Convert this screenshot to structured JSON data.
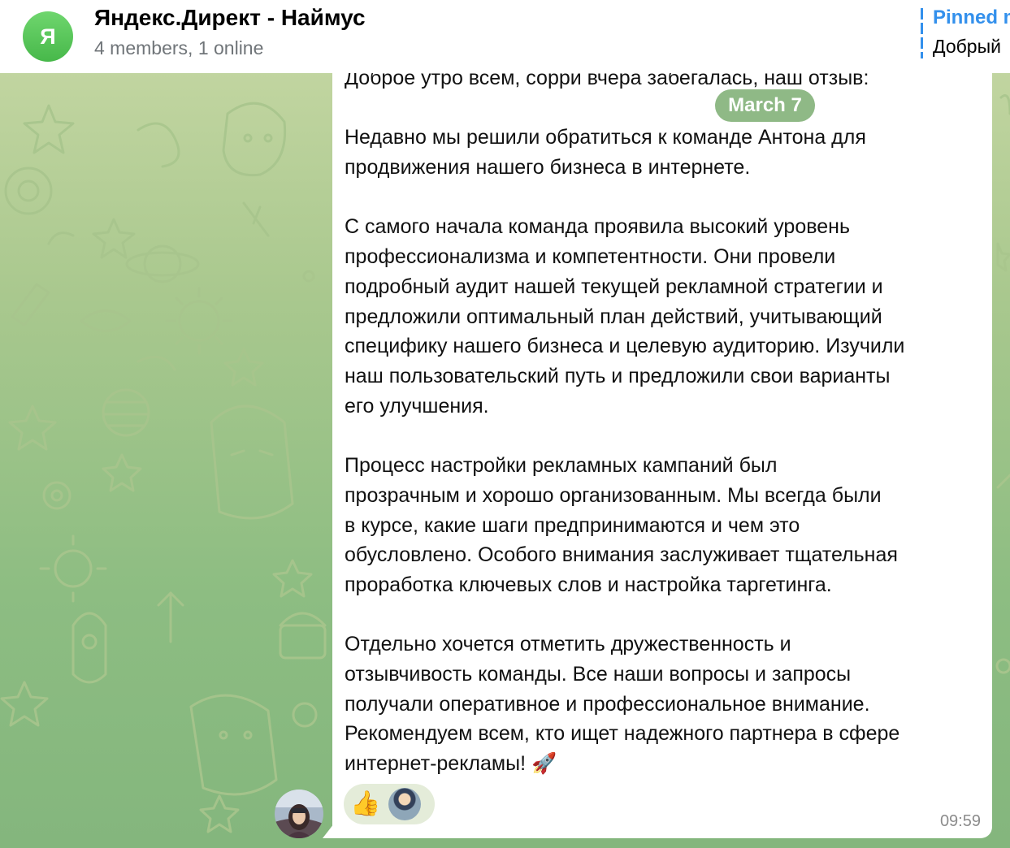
{
  "header": {
    "avatar_letter": "Я",
    "title": "Яндекс.Директ - Наймус",
    "status": "4 members, 1 online",
    "pinned_label": "Pinned m",
    "pinned_preview": "Добрый"
  },
  "date_badge": "March 7",
  "message": {
    "paragraphs": [
      "Доброе утро всем, сорри вчера забегалась, наш отзыв:",
      "Недавно мы решили обратиться к команде Антона для\nпродвижения нашего бизнеса в интернете.",
      "С самого начала команда проявила высокий уровень\nпрофессионализма и компетентности. Они провели\nподробный аудит нашей текущей рекламной стратегии и\nпредложили оптимальный план действий, учитывающий\nспецифику нашего бизнеса и целевую аудиторию. Изучили\nнаш пользовательский путь и предложили свои варианты\nего улучшения.",
      "Процесс настройки рекламных кампаний был\nпрозрачным и хорошо организованным. Мы всегда были\nв курсе, какие шаги предпринимаются и чем это\nобусловлено. Особого внимания заслуживает тщательная\nпроработка ключевых слов и настройка таргетинга.",
      "Отдельно хочется отметить дружественность и\nотзывчивость команды. Все наши вопросы и запросы\nполучали оперативное и профессиональное внимание.\n Рекомендуем всем, кто ищет надежного партнера в сфере\nинтернет-рекламы! 🚀"
    ],
    "reaction_emoji": "👍",
    "time": "09:59"
  },
  "colors": {
    "accent": "#3390ec",
    "avatar_green": "#47b84a",
    "date_pill": "#8fb986",
    "reaction_bg": "#e4ecd9"
  }
}
